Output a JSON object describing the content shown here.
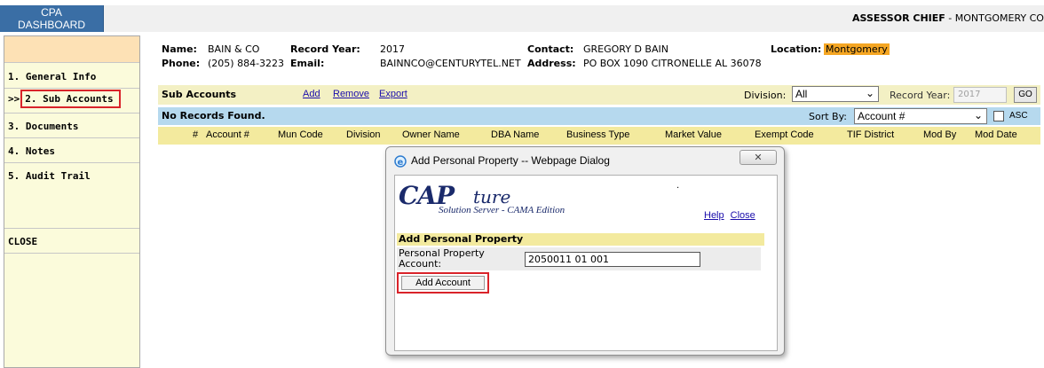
{
  "topbar": {
    "dashboard_line1": "CPA",
    "dashboard_line2": "DASHBOARD",
    "role": "ASSESSOR CHIEF",
    "org": " - MONTGOMERY CO"
  },
  "sidebar": {
    "items": [
      {
        "label": "1. General Info"
      },
      {
        "arrow": ">>",
        "label": "2. Sub Accounts"
      },
      {
        "label": "3. Documents"
      },
      {
        "label": "4. Notes"
      },
      {
        "label": "5. Audit Trail"
      },
      {
        "label": "CLOSE"
      }
    ]
  },
  "info": {
    "name_label": "Name:",
    "name": "BAIN & CO",
    "phone_label": "Phone:",
    "phone": "(205) 884-3223",
    "record_year_label": "Record Year:",
    "record_year": "2017",
    "email_label": "Email:",
    "email": "BAINNCO@CENTURYTEL.NET",
    "contact_label": "Contact:",
    "contact": "GREGORY D BAIN",
    "address_label": "Address:",
    "address": "PO BOX 1090 CITRONELLE AL 36078",
    "location_label": "Location:",
    "location": "Montgomery"
  },
  "subaccounts": {
    "title": "Sub Accounts",
    "add": "Add",
    "remove": "Remove",
    "export": "Export",
    "division_label": "Division:",
    "division_value": "All",
    "record_year_label": "Record Year:",
    "record_year_value": "2017",
    "go": "GO",
    "no_records": "No Records Found.",
    "sort_by_label": "Sort By:",
    "sort_by_value": "Account #",
    "asc": "ASC",
    "columns": [
      "#",
      "Account #",
      "Mun Code",
      "Division",
      "Owner Name",
      "DBA Name",
      "Business Type",
      "Market Value",
      "Exempt Code",
      "TIF District",
      "Mod By",
      "Mod Date"
    ]
  },
  "dialog": {
    "title": "Add Personal Property -- Webpage Dialog",
    "close_glyph": "✕",
    "logo_main": "CAP",
    "logo_script": "ture",
    "logo_sub": "Solution Server - CAMA Edition",
    "help": "Help",
    "close": "Close",
    "dot": ".",
    "section_title": "Add Personal Property",
    "field_label": "Personal Property Account:",
    "field_value": "2050011 01 001",
    "add_button": "Add Account"
  },
  "colors": {
    "dashboard": "#3a6ea5",
    "highlight": "#d9232a",
    "location": "#f5a623"
  }
}
